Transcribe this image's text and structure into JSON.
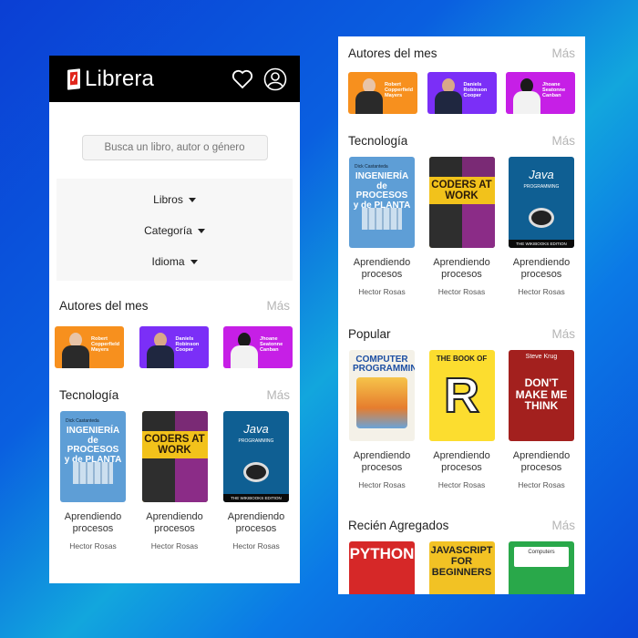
{
  "app": {
    "name": "Librera"
  },
  "search": {
    "placeholder": "Busca un libro, autor o género"
  },
  "filters": [
    "Libros",
    "Categoría",
    "Idioma"
  ],
  "colors": {
    "header_bg": "#000000",
    "more_link": "#b5b5b5",
    "bg_gradient_start": "#0b3fd4",
    "bg_gradient_mid": "#12a6dd"
  },
  "sections": {
    "authors": {
      "title": "Autores del mes",
      "more": "Más",
      "items": [
        {
          "name": "Robert Copperfield Mayers",
          "bg": "#f7901e"
        },
        {
          "name": "Daniels Robinson Cooper",
          "bg": "#7b2ff7"
        },
        {
          "name": "Jhoane Seatonne Canban",
          "bg": "#c61fe6"
        }
      ]
    },
    "tecnologia": {
      "title": "Tecnología",
      "more": "Más",
      "items": [
        {
          "title": "Aprendiendo procesos",
          "author": "Hector Rosas",
          "cover_text": "INGENIERÍA de PROCESOS y de PLANTA",
          "cover_sub": "Dick Castanteda"
        },
        {
          "title": "Aprendiendo procesos",
          "author": "Hector Rosas",
          "cover_text": "CODERS AT WORK"
        },
        {
          "title": "Aprendiendo procesos",
          "author": "Hector Rosas",
          "cover_text": "Java",
          "cover_sub": "PROGRAMMING",
          "cover_band": "THE WIKIBOOKS EDITION"
        }
      ]
    },
    "popular": {
      "title": "Popular",
      "more": "Más",
      "items": [
        {
          "title": "Aprendiendo procesos",
          "author": "Hector Rosas",
          "cover_text": "COMPUTER PROGRAMMING"
        },
        {
          "title": "Aprendiendo procesos",
          "author": "Hector Rosas",
          "cover_text": "THE BOOK OF",
          "cover_big": "R"
        },
        {
          "title": "Aprendiendo procesos",
          "author": "Hector Rosas",
          "cover_top": "Steve Krug",
          "cover_text": "DON'T MAKE ME THINK"
        }
      ]
    },
    "recientes": {
      "title": "Recién Agregados",
      "more": "Más",
      "items": [
        {
          "cover_text": "PYTHON"
        },
        {
          "cover_text": "JAVASCRIPT FOR BEGINNERS"
        },
        {
          "cover_text": "Computers"
        }
      ]
    }
  }
}
